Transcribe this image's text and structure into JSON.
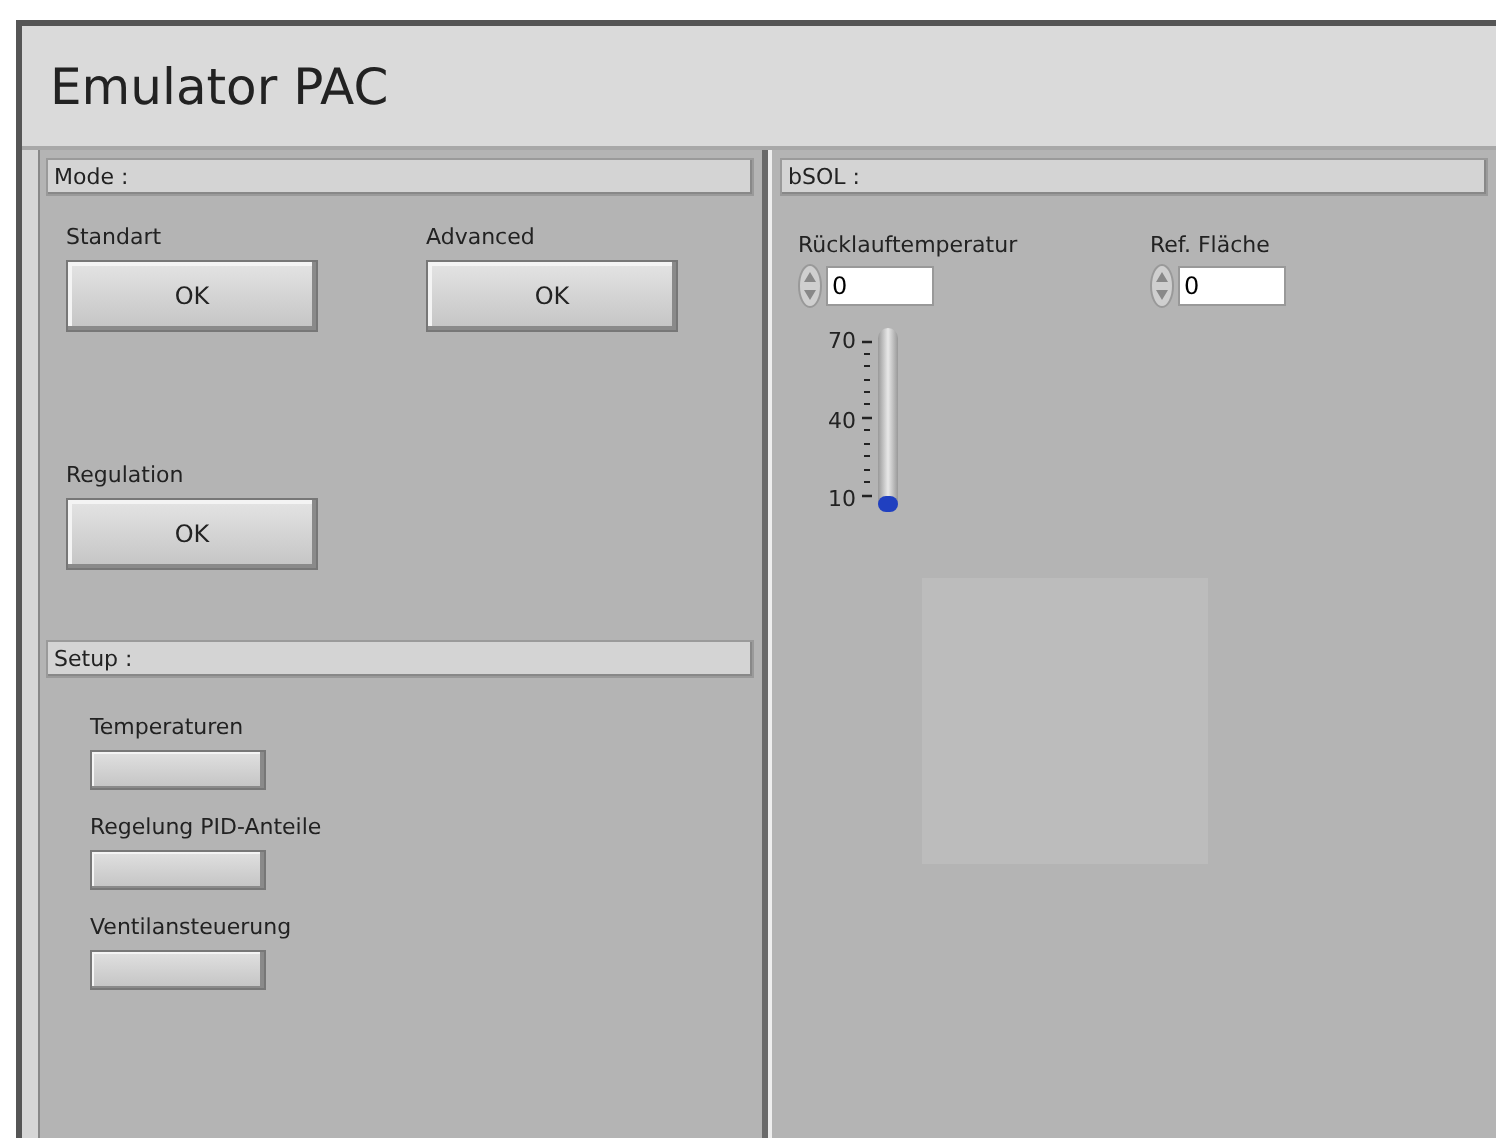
{
  "window": {
    "title": "Emulator PAC"
  },
  "mode": {
    "header": "Mode :",
    "buttons": [
      {
        "label": "Standart",
        "text": "OK"
      },
      {
        "label": "Advanced",
        "text": "OK"
      },
      {
        "label": "Regulation",
        "text": "OK"
      }
    ]
  },
  "setup": {
    "header": "Setup :",
    "buttons": [
      {
        "label": "Temperaturen"
      },
      {
        "label": "Regelung PID-Anteile"
      },
      {
        "label": "Ventilansteuerung"
      }
    ]
  },
  "bsol": {
    "header": "bSOL :",
    "inputs": [
      {
        "label": "Rücklauftemperatur",
        "value": "0"
      },
      {
        "label": "Ref. Fläche",
        "value": "0"
      }
    ],
    "thermometer": {
      "level": 0,
      "ticks": [
        "70",
        "40",
        "10"
      ]
    }
  }
}
